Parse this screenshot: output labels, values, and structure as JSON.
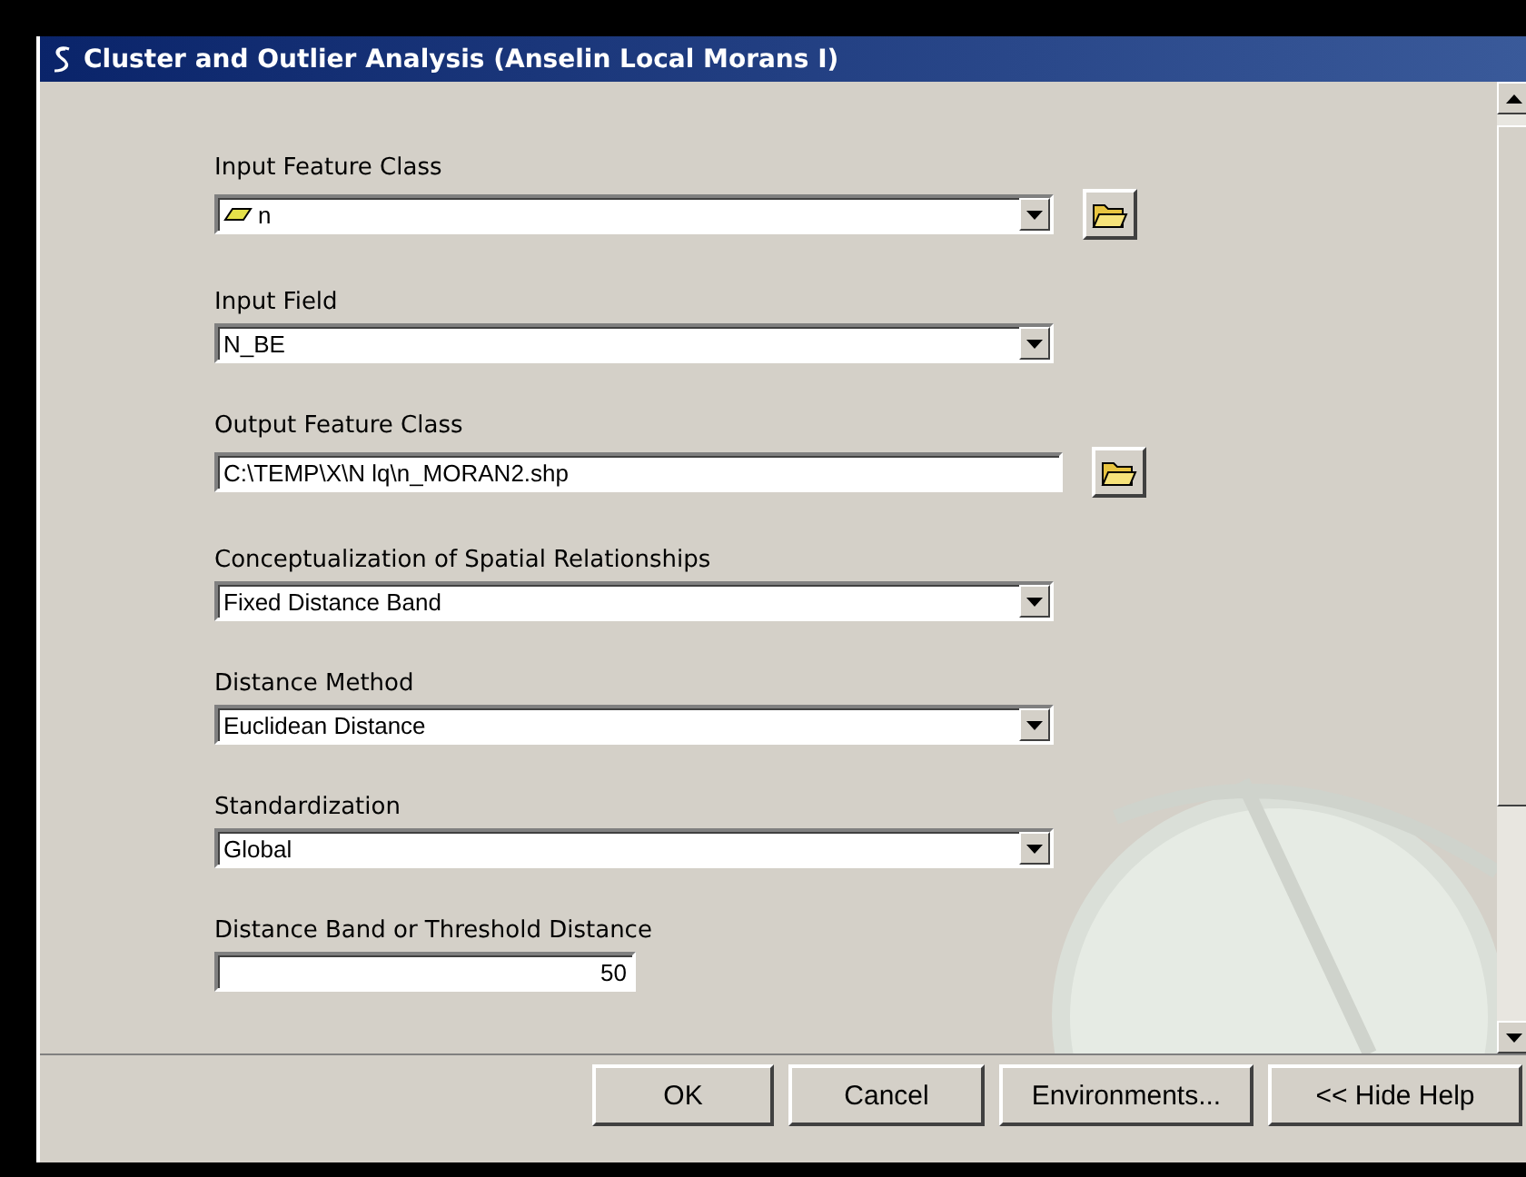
{
  "window": {
    "title": "Cluster and Outlier Analysis (Anselin Local Morans I)"
  },
  "parameters": [
    {
      "label": "Input Feature Class",
      "kind": "combo",
      "value": "n",
      "layer_icon": true,
      "browse": true
    },
    {
      "label": "Input Field",
      "kind": "combo",
      "value": "N_BE"
    },
    {
      "label": "Output Feature Class",
      "kind": "text",
      "value": "C:\\TEMP\\X\\N lq\\n_MORAN2.shp",
      "browse": true
    },
    {
      "label": "Conceptualization of Spatial Relationships",
      "kind": "combo",
      "value": "Fixed Distance Band"
    },
    {
      "label": "Distance Method",
      "kind": "combo",
      "value": "Euclidean Distance"
    },
    {
      "label": "Standardization",
      "kind": "combo",
      "value": "Global"
    },
    {
      "label": "Distance Band or Threshold Distance",
      "kind": "number",
      "value": "50"
    }
  ],
  "buttons": [
    "OK",
    "Cancel",
    "Environments...",
    "<< Hide Help"
  ]
}
